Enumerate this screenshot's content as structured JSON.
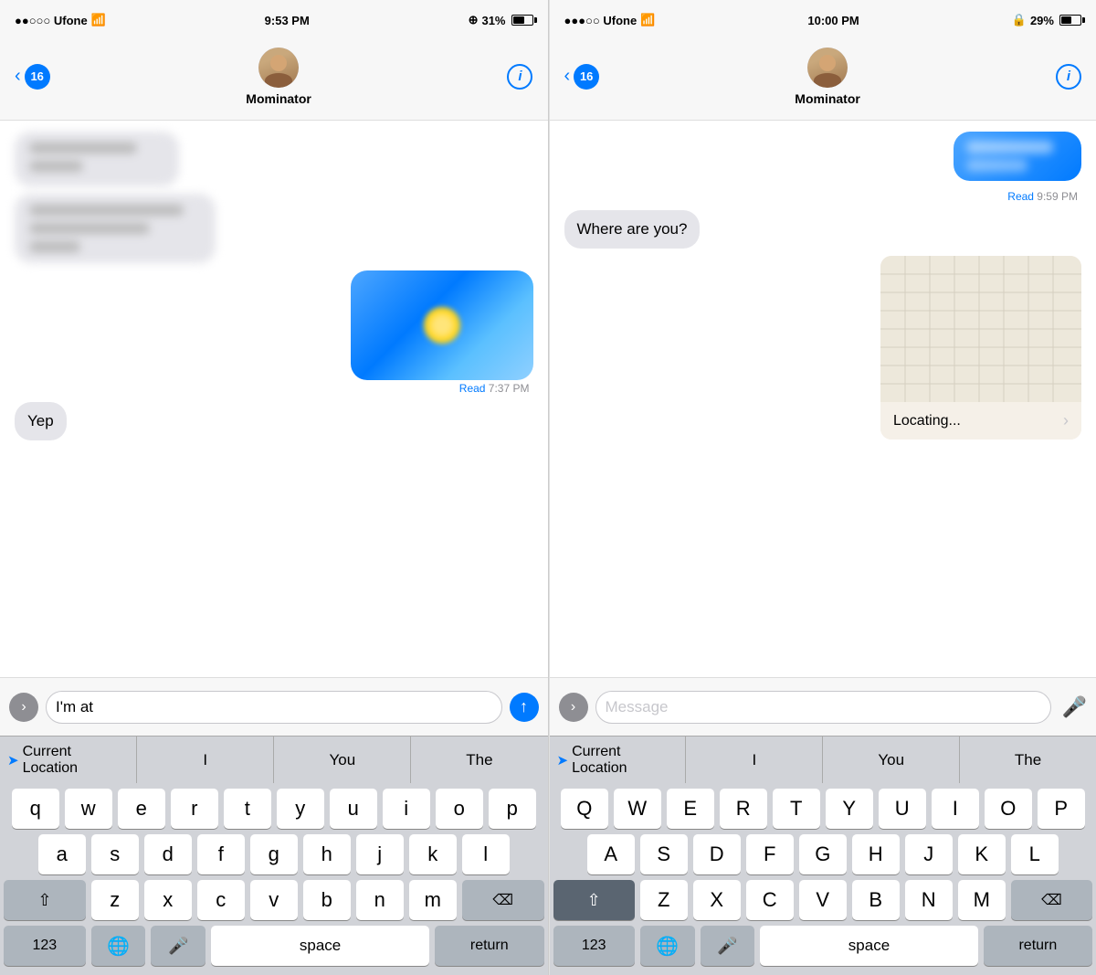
{
  "leftPanel": {
    "statusBar": {
      "carrier": "●●○○○ Ufone",
      "wifi": "wifi",
      "time": "9:53 PM",
      "location": "⊕",
      "battery": "31%"
    },
    "nav": {
      "backCount": "16",
      "contactName": "Mominator",
      "infoLabel": "i"
    },
    "messages": [
      {
        "id": "m1",
        "type": "incoming",
        "blurred": true,
        "text": "blurred message line 1\nblurred line 2"
      },
      {
        "id": "m2",
        "type": "incoming",
        "blurred": true,
        "text": "blurred message line 3 blurred message line 3\nblurred"
      },
      {
        "id": "m3",
        "type": "outgoing-image",
        "readLabel": "Read",
        "readTime": "7:37 PM"
      },
      {
        "id": "m4",
        "type": "incoming",
        "text": "Yep"
      }
    ],
    "input": {
      "expandIcon": "›",
      "typedText": "I'm at ",
      "sendIcon": "↑"
    },
    "autocomplete": {
      "items": [
        {
          "id": "loc",
          "label": "Current Location",
          "hasArrow": true
        },
        {
          "id": "i",
          "label": "I"
        },
        {
          "id": "you",
          "label": "You"
        },
        {
          "id": "the",
          "label": "The"
        }
      ]
    },
    "keyboard": {
      "row1": [
        "q",
        "w",
        "e",
        "r",
        "t",
        "y",
        "u",
        "i",
        "o",
        "p"
      ],
      "row2": [
        "a",
        "s",
        "d",
        "f",
        "g",
        "h",
        "j",
        "k",
        "l"
      ],
      "row3": [
        "z",
        "x",
        "c",
        "v",
        "b",
        "n",
        "m"
      ],
      "bottomLeft": "123",
      "bottomEmoji": "🌐",
      "bottomMic": "🎤",
      "bottomSpace": "space",
      "bottomReturn": "return"
    }
  },
  "rightPanel": {
    "statusBar": {
      "carrier": "●●●○○ Ufone",
      "wifi": "wifi",
      "time": "10:00 PM",
      "lock": "🔒",
      "battery": "29%"
    },
    "nav": {
      "backCount": "16",
      "contactName": "Mominator",
      "infoLabel": "i"
    },
    "messages": [
      {
        "id": "r1",
        "type": "outgoing-blue",
        "text": "blurred outgoing",
        "blurred": true
      },
      {
        "id": "r2",
        "type": "read-receipt",
        "label": "Read",
        "time": "9:59 PM"
      },
      {
        "id": "r3",
        "type": "incoming",
        "text": "Where are you?"
      },
      {
        "id": "r4",
        "type": "locating-card"
      }
    ],
    "locating": {
      "label": "Locating..."
    },
    "input": {
      "expandIcon": "›",
      "placeholder": "Message",
      "micIcon": "🎤"
    },
    "autocomplete": {
      "items": [
        {
          "id": "loc",
          "label": "Current Location",
          "hasArrow": true
        },
        {
          "id": "i",
          "label": "I"
        },
        {
          "id": "you",
          "label": "You"
        },
        {
          "id": "the",
          "label": "The"
        }
      ]
    },
    "keyboard": {
      "row1": [
        "Q",
        "W",
        "E",
        "R",
        "T",
        "Y",
        "U",
        "I",
        "O",
        "P"
      ],
      "row2": [
        "A",
        "S",
        "D",
        "F",
        "G",
        "H",
        "J",
        "K",
        "L"
      ],
      "row3": [
        "Z",
        "X",
        "C",
        "V",
        "B",
        "N",
        "M"
      ],
      "bottomLeft": "123",
      "bottomEmoji": "🌐",
      "bottomMic": "🎤",
      "bottomSpace": "space",
      "bottomReturn": "return"
    }
  }
}
